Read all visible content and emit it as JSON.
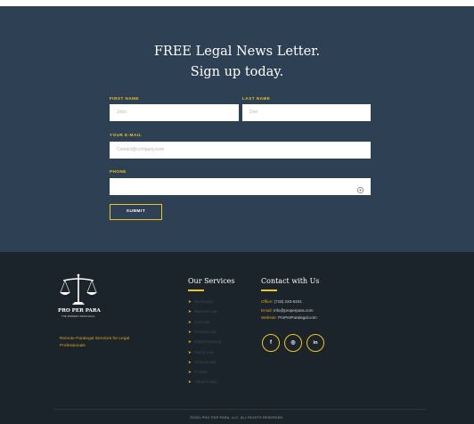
{
  "newsletter": {
    "title_line1": "FREE Legal News Letter.",
    "title_line2": "Sign up today.",
    "first_name_label": "FIRST NAME",
    "first_name_placeholder": "John",
    "last_name_label": "LAST NAME",
    "last_name_placeholder": "Doe",
    "email_label": "YOUR E-MAIL",
    "email_placeholder": "Contact@company.com",
    "phone_label": "PHONE",
    "phone_placeholder": "",
    "submit_label": "SUBMIT"
  },
  "footer": {
    "logo_name": "PRO PER PARA",
    "logo_tagline": "THE MODERN PARALEGAL",
    "tagline": "Remote Paralegal Services for Legal Professionals",
    "services_title": "Our Services",
    "services": [
      "Bankruptcy",
      "Business Law",
      "Civil Law",
      "Criminal Law",
      "Estate Planning",
      "Family Law",
      "General Law",
      "Probate",
      "Virtual Notary"
    ],
    "contact_title": "Contact with Us",
    "office_label": "Office:",
    "office_value": "(718) 233-6201",
    "email_label": "Email:",
    "email_value": "info@properpara.com",
    "website_label": "Website:",
    "website_value": "ProPerParalegal.com",
    "social": [
      "f",
      "◎",
      "in"
    ],
    "copyright": "©2021 PRO PER PARA, LLC. ALL RIGHTS RESERVED."
  },
  "colors": {
    "newsletter_bg": "#2e4054",
    "footer_bg": "#1b242a",
    "accent": "#f0c419"
  },
  "icons": [
    "phone-icon",
    "scales-logo-icon",
    "facebook-icon",
    "instagram-icon",
    "linkedin-icon",
    "chevron-right-icon"
  ]
}
